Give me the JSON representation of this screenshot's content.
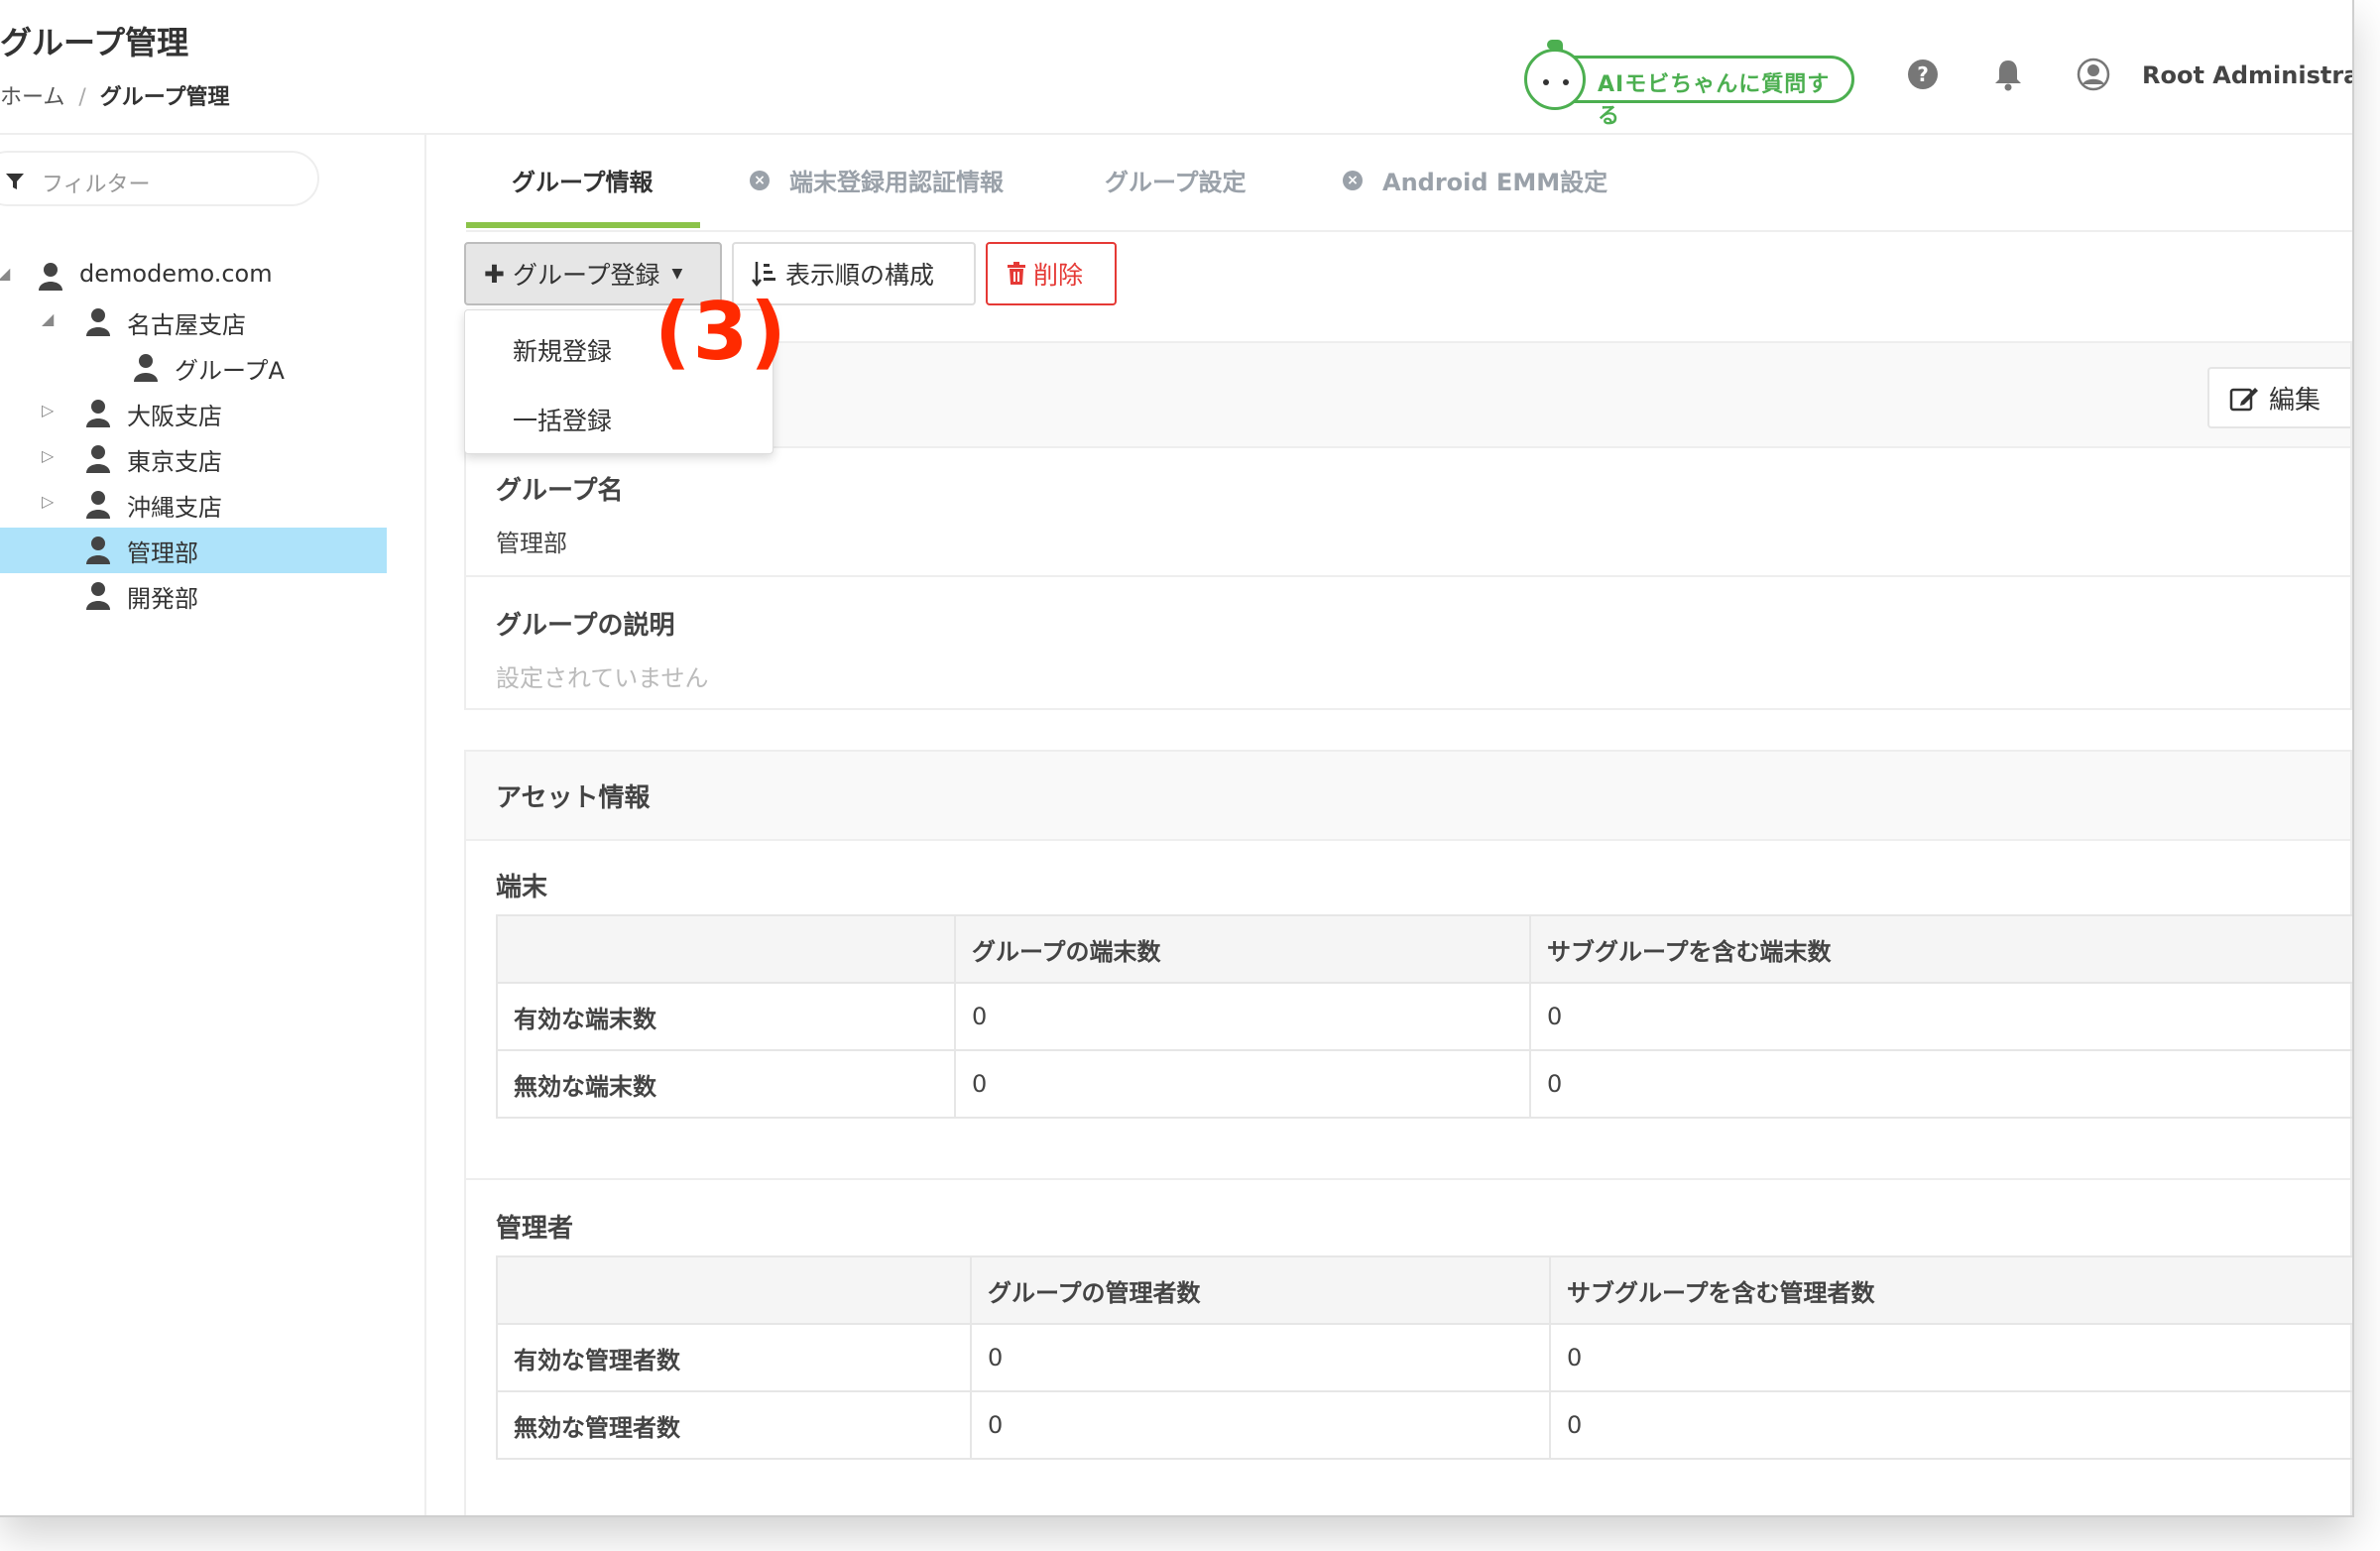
{
  "header": {
    "title": "グループ管理",
    "breadcrumb": {
      "home": "ホーム",
      "sep": "/",
      "current": "グループ管理"
    },
    "ai_button_label": "AIモビちゃんに質問する",
    "user_name": "Root Administrat"
  },
  "sidebar": {
    "filter_placeholder": "フィルター",
    "tree": [
      {
        "label": "demodemo.com",
        "caret": "◢"
      },
      {
        "label": "名古屋支店",
        "caret": "◢"
      },
      {
        "label": "グループA",
        "caret": ""
      },
      {
        "label": "大阪支店",
        "caret": "▷"
      },
      {
        "label": "東京支店",
        "caret": "▷"
      },
      {
        "label": "沖縄支店",
        "caret": "▷"
      },
      {
        "label": "管理部",
        "caret": "",
        "selected": true
      },
      {
        "label": "開発部",
        "caret": ""
      }
    ]
  },
  "tabs": [
    {
      "label": "グループ情報",
      "active": true
    },
    {
      "label": "端末登録用認証情報",
      "icon": "x-circle-icon"
    },
    {
      "label": "グループ設定"
    },
    {
      "label": "Android EMM設定",
      "icon": "x-circle-icon"
    }
  ],
  "toolbar": {
    "register_label": "グループ登録",
    "order_label": "表示順の構成",
    "delete_label": "削除"
  },
  "dropdown": {
    "items": [
      "新規登録",
      "一括登録"
    ]
  },
  "annotation": "(3)",
  "info": {
    "edit_label": "編集",
    "name_label": "グループ名",
    "name_value": "管理部",
    "desc_label": "グループの説明",
    "desc_value": "設定されていません"
  },
  "assets": {
    "title": "アセット情報",
    "devices": {
      "title": "端末",
      "headers": [
        "",
        "グループの端末数",
        "サブグループを含む端末数"
      ],
      "rows": [
        {
          "label": "有効な端末数",
          "group": "0",
          "sub": "0"
        },
        {
          "label": "無効な端末数",
          "group": "0",
          "sub": "0"
        }
      ]
    },
    "admins": {
      "title": "管理者",
      "headers": [
        "",
        "グループの管理者数",
        "サブグループを含む管理者数"
      ],
      "rows": [
        {
          "label": "有効な管理者数",
          "group": "0",
          "sub": "0"
        },
        {
          "label": "無効な管理者数",
          "group": "0",
          "sub": "0"
        }
      ]
    }
  },
  "colors": {
    "accent_green": "#8bc34a",
    "ai_green": "#4caf50",
    "danger": "#e53935",
    "selected": "#aee3fa",
    "annotation": "#ff2a00"
  }
}
